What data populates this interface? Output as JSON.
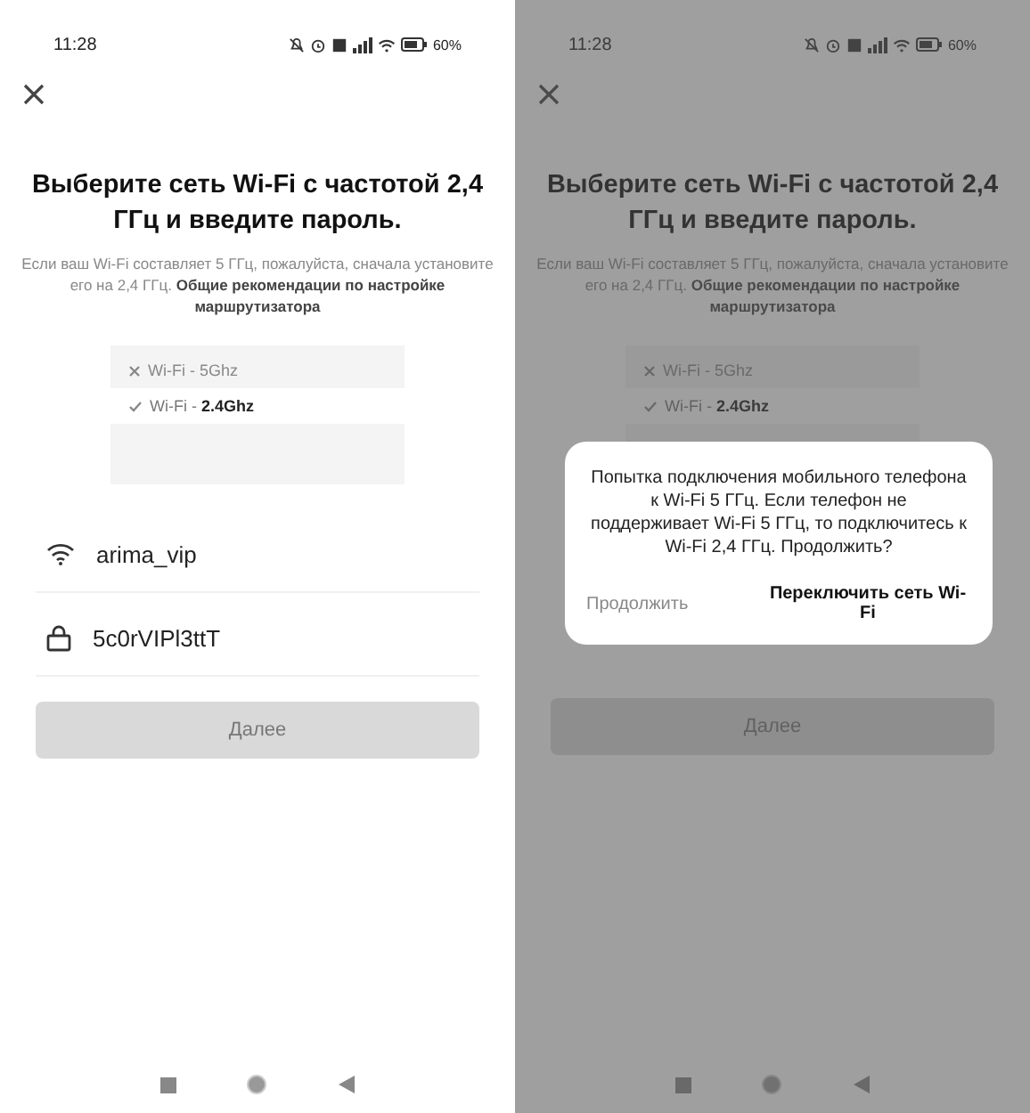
{
  "screens": [
    {
      "status_bar": {
        "time": "11:28",
        "battery": "60%"
      },
      "title": "Выберите сеть Wi-Fi с частотой 2,4 ГГц и введите пароль.",
      "hint": "Если ваш Wi-Fi составляет 5 ГГц, пожалуйста, сначала установите его на 2,4 ГГц. **Общие рекомендации по настройке маршрутизатора**",
      "illustration": {
        "rows": [
          {
            "label": "Wi-Fi - 5Ghz",
            "selected": false
          },
          {
            "label": "Wi-Fi - **2.4Ghz**",
            "selected": true
          }
        ]
      },
      "network": {
        "value": "arima_vip"
      },
      "password": {
        "value": "5c0rVIPl3ttT"
      },
      "next_button": {
        "label": "Далее",
        "disabled": true
      }
    },
    {
      "status_bar": {
        "time": "11:28",
        "battery": "60%"
      },
      "title": "Выберите сеть Wi-Fi с частотой 2,4 ГГц и введите пароль.",
      "hint": "Если ваш Wi-Fi составляет 5 ГГц, пожалуйста, сначала установите его на 2,4 ГГц. **Общие рекомендации по настройке маршрутизатора**",
      "illustration": {
        "rows": [
          {
            "label": "Wi-Fi - 5Ghz",
            "selected": false
          },
          {
            "label": "Wi-Fi - **2.4Ghz**",
            "selected": true
          }
        ]
      },
      "next_button": {
        "label": "Далее",
        "disabled": true
      },
      "dialog": {
        "message": "Попытка подключения мобильного телефона к Wi-Fi 5 ГГц. Если телефон не поддерживает Wi-Fi 5 ГГц, то подключитесь к Wi-Fi 2,4 ГГц. Продолжить?",
        "buttons": [
          {
            "label": "Продолжить",
            "primary": false
          },
          {
            "label": "Переключить сеть Wi-Fi",
            "primary": true
          }
        ]
      }
    }
  ]
}
